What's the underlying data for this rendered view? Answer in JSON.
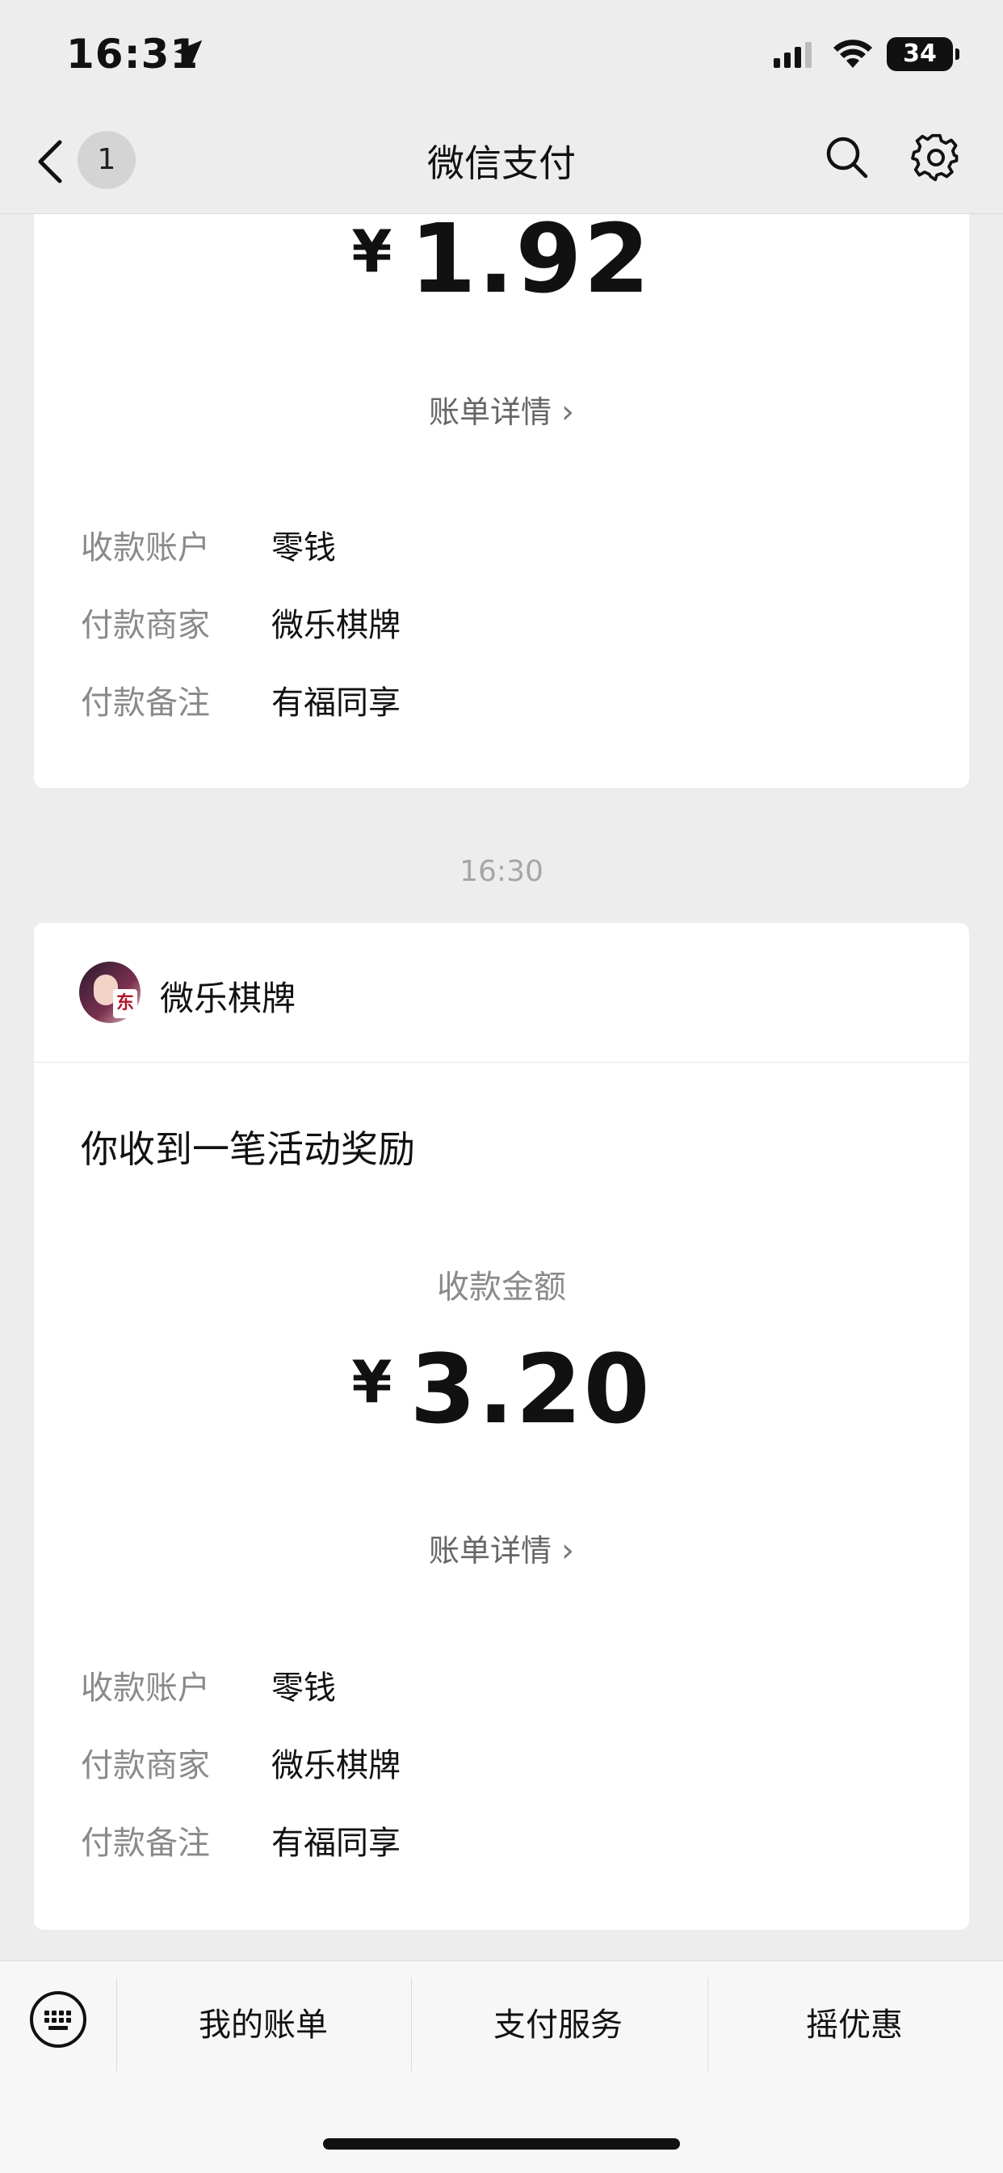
{
  "status_bar": {
    "time": "16:31",
    "battery": "34"
  },
  "nav": {
    "badge": "1",
    "title": "微信支付"
  },
  "card1": {
    "currency": "¥",
    "amount": "1.92",
    "detail_link": "账单详情",
    "rows": [
      {
        "label": "收款账户",
        "value": "零钱"
      },
      {
        "label": "付款商家",
        "value": "微乐棋牌"
      },
      {
        "label": "付款备注",
        "value": "有福同享"
      }
    ]
  },
  "timestamp": "16:30",
  "card2": {
    "merchant_name": "微乐棋牌",
    "avatar_tile": "东",
    "notice_title": "你收到一笔活动奖励",
    "amount_label": "收款金额",
    "currency": "¥",
    "amount": "3.20",
    "detail_link": "账单详情",
    "rows": [
      {
        "label": "收款账户",
        "value": "零钱"
      },
      {
        "label": "付款商家",
        "value": "微乐棋牌"
      },
      {
        "label": "付款备注",
        "value": "有福同享"
      }
    ]
  },
  "bottom_menu": {
    "items": [
      {
        "label": "我的账单"
      },
      {
        "label": "支付服务"
      },
      {
        "label": "摇优惠"
      }
    ]
  },
  "icons": {
    "back": "chevron-left-icon",
    "search": "search-icon",
    "settings": "gear-icon",
    "keyboard": "keyboard-icon",
    "location": "location-arrow-icon"
  }
}
